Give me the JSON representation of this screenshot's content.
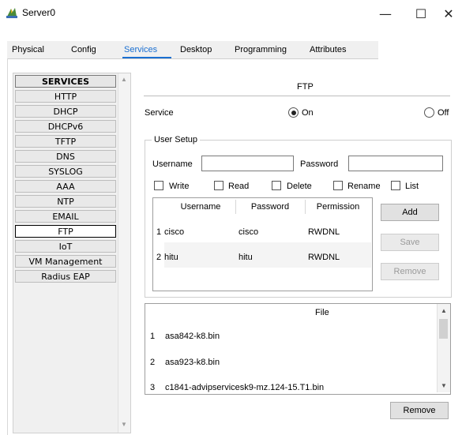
{
  "window": {
    "title": "Server0",
    "minimize_glyph": "—",
    "maximize_glyph": "☐",
    "close_glyph": "✕",
    "icon": "server-icon"
  },
  "tabs": [
    {
      "label": "Physical",
      "active": false
    },
    {
      "label": "Config",
      "active": false
    },
    {
      "label": "Services",
      "active": true
    },
    {
      "label": "Desktop",
      "active": false
    },
    {
      "label": "Programming",
      "active": false
    },
    {
      "label": "Attributes",
      "active": false
    }
  ],
  "services": {
    "header": "SERVICES",
    "items": [
      "HTTP",
      "DHCP",
      "DHCPv6",
      "TFTP",
      "DNS",
      "SYSLOG",
      "AAA",
      "NTP",
      "EMAIL",
      "FTP",
      "IoT",
      "VM Management",
      "Radius EAP"
    ],
    "selected": "FTP"
  },
  "ftp": {
    "title": "FTP",
    "service_label": "Service",
    "on_label": "On",
    "off_label": "Off",
    "service_state": "On",
    "user_setup": {
      "legend": "User Setup",
      "username_label": "Username",
      "username_value": "",
      "password_label": "Password",
      "password_value": "",
      "permissions": [
        {
          "label": "Write",
          "checked": false
        },
        {
          "label": "Read",
          "checked": false
        },
        {
          "label": "Delete",
          "checked": false
        },
        {
          "label": "Rename",
          "checked": false
        },
        {
          "label": "List",
          "checked": false
        }
      ],
      "table": {
        "columns": [
          "Username",
          "Password",
          "Permission"
        ],
        "rows": [
          {
            "num": "1",
            "username": "cisco",
            "password": "cisco",
            "permission": "RWDNL"
          },
          {
            "num": "2",
            "username": "hitu",
            "password": "hitu",
            "permission": "RWDNL"
          }
        ]
      },
      "buttons": {
        "add": "Add",
        "save": "Save",
        "remove": "Remove"
      }
    },
    "files": {
      "column": "File",
      "items": [
        {
          "num": "1",
          "name": "asa842-k8.bin"
        },
        {
          "num": "2",
          "name": "asa923-k8.bin"
        },
        {
          "num": "3",
          "name": "c1841-advipservicesk9-mz.124-15.T1.bin"
        }
      ],
      "remove_label": "Remove"
    }
  },
  "colors": {
    "accent": "#1a6fd1",
    "selected_row": "#f4f4f4"
  }
}
